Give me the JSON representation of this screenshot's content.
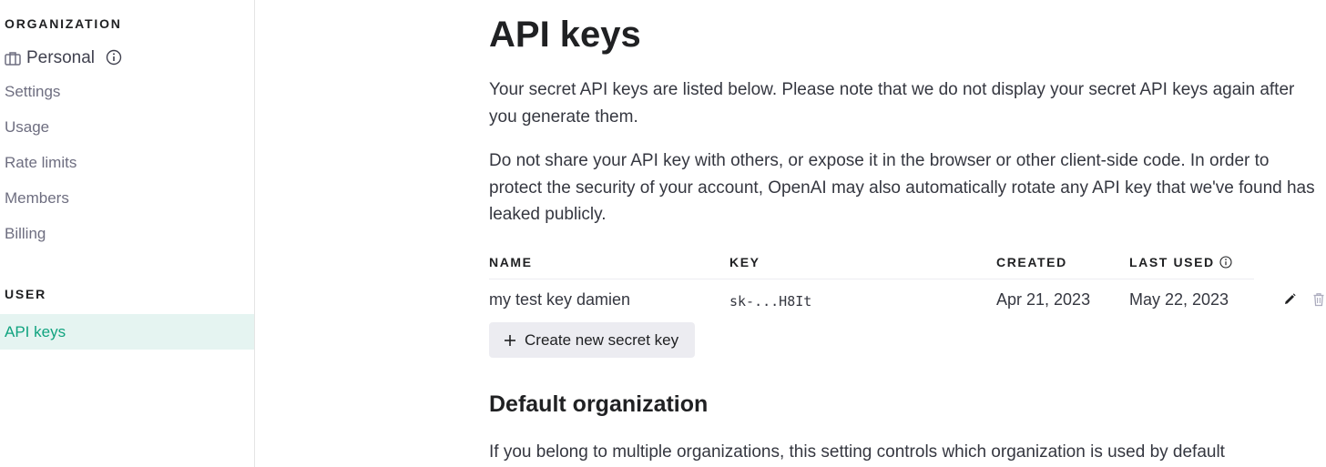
{
  "sidebar": {
    "organization_heading": "ORGANIZATION",
    "org_name": "Personal",
    "org_items": [
      {
        "label": "Settings"
      },
      {
        "label": "Usage"
      },
      {
        "label": "Rate limits"
      },
      {
        "label": "Members"
      },
      {
        "label": "Billing"
      }
    ],
    "user_heading": "USER",
    "user_items": [
      {
        "label": "API keys",
        "active": true
      }
    ]
  },
  "main": {
    "title": "API keys",
    "intro_1": "Your secret API keys are listed below. Please note that we do not display your secret API keys again after you generate them.",
    "intro_2": "Do not share your API key with others, or expose it in the browser or other client-side code. In order to protect the security of your account, OpenAI may also automatically rotate any API key that we've found has leaked publicly.",
    "table": {
      "headers": {
        "name": "NAME",
        "key": "KEY",
        "created": "CREATED",
        "last_used": "LAST USED"
      },
      "rows": [
        {
          "name": "my test key damien",
          "key": "sk-...H8It",
          "created": "Apr 21, 2023",
          "last_used": "May 22, 2023",
          "actions": [
            "pencil-icon",
            "trash-icon"
          ]
        }
      ]
    },
    "create_button_label": "Create new secret key",
    "default_org_heading": "Default organization",
    "default_org_text": "If you belong to multiple organizations, this setting controls which organization is used by default"
  },
  "colors": {
    "accent": "#10a37f",
    "active_bg": "#e5f4f1",
    "button_bg": "#ececf1",
    "muted_text": "#6e6e80"
  }
}
